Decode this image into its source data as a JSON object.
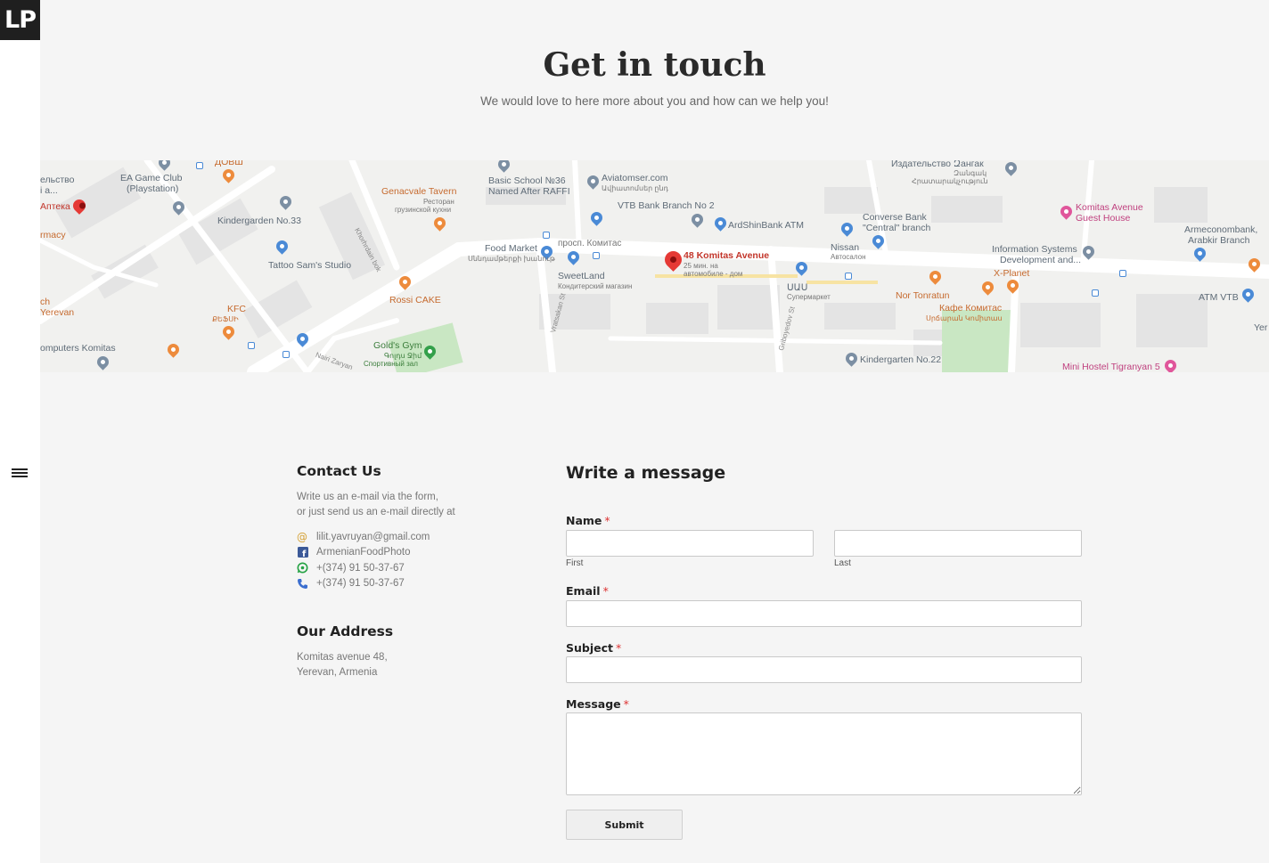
{
  "brand": {
    "logo_text": "LP"
  },
  "hero": {
    "title": "Get in touch",
    "subtitle": "We would love to here more about you and how can we help you!"
  },
  "map": {
    "main_marker": {
      "name": "48 Komitas Avenue",
      "sub1": "25 мин. на",
      "sub2": "автомобиле - дом"
    },
    "labels": {
      "ea_game_club": "EA Game Club",
      "ea_game_club_2": "(Playstation)",
      "kindergarden33": "Kindergarden No.33",
      "tattoo": "Tattoo Sam's Studio",
      "genacvale": "Genacvale Tavern",
      "genacvale_sub1": "Ресторан",
      "genacvale_sub2": "грузинской кухни",
      "basic_school": "Basic School №36",
      "basic_school_2": "Named After RAFFI",
      "aviatomser": "Aviatomser.com",
      "aviatomser_sub": "Ավիատոմսեր ընդ",
      "vtb2": "VTB Bank Branch No 2",
      "ardshin": "ArdShinBank ATM",
      "converse": "Converse Bank",
      "converse_2": "\"Central\" branch",
      "izdatelstvo": "Издательство Զангак",
      "izdatelstvo_2": "Զանգակ",
      "izdatelstvo_3": "Հրատարակչություն",
      "komitas_guest": "Komitas Avenue",
      "komitas_guest_2": "Guest House",
      "armeconom": "Armeconombank,",
      "armeconom_2": "Arabkir Branch",
      "info_systems": "Information Systems",
      "info_systems_2": "Development and...",
      "x_planet": "X-Planet",
      "nor_tonratun": "Nor Tonratun",
      "cafe_komitas": "Кафе Комитас",
      "cafe_komitas_sub": "Սրճարան Կոմիտաս",
      "atm_vtb": "ATM VTB",
      "nissan": "Nissan",
      "nissan_sub": "Автосалон",
      "uuu": "ՍԱՍ",
      "uuu_sub": "Супермаркет",
      "food_market": "Food Market",
      "food_market_sub": "Սննդամթերքի խանութ",
      "prosp": "просп. Комитас",
      "sweetland": "SweetLand",
      "sweetland_sub": "Кондитерский магазин",
      "rossi": "Rossi CAKE",
      "kfc": "KFC",
      "kfc_sub": "ՔԵՖՍԻ",
      "golds_gym": "Gold's Gym",
      "golds_gym_sub1": "Գոլդս Ջիմ",
      "golds_gym_sub2": "Спортивный зал",
      "computers_komitas": "omputers Komitas",
      "kindergarten22": "Kindergarten No.22",
      "mini_hostel": "Mini Hostel Tigranyan 5",
      "apteka": "Аптека",
      "macy": "rmacy",
      "yerevan": "Yerevan",
      "ch": "ch",
      "elstvo": "ельство",
      "ia": "і а...",
      "dovsh": "ДОВШ",
      "yer_right": "Yer",
      "street_vratsakan": "Vratsakan St",
      "street_griboyedov": "Griboyedov St",
      "street_khorhrdain": "Khorhrdain bok",
      "street_nairi": "Nairi Zaryan"
    }
  },
  "contact": {
    "heading": "Contact Us",
    "intro_line1": "Write us an e-mail via the form,",
    "intro_line2": "or just send us an e-mail directly at",
    "email": "lilit.yavruyan@gmail.com",
    "facebook": "ArmenianFoodPhoto",
    "whatsapp": "+(374) 91 50-37-67",
    "phone": "+(374) 91 50-37-67",
    "icons": {
      "email": "at-sign-icon",
      "facebook": "facebook-icon",
      "whatsapp": "whatsapp-icon",
      "phone": "phone-icon"
    },
    "colors": {
      "email": "#d4a034",
      "facebook": "#3b5998",
      "whatsapp": "#25a244",
      "phone": "#3b6ecf"
    }
  },
  "address": {
    "heading": "Our Address",
    "line1": "Komitas avenue 48,",
    "line2": "Yerevan, Armenia"
  },
  "form": {
    "title": "Write a message",
    "name_label": "Name",
    "required_mark": "*",
    "first_sublabel": "First",
    "last_sublabel": "Last",
    "email_label": "Email",
    "subject_label": "Subject",
    "message_label": "Message",
    "first_value": "",
    "last_value": "",
    "email_value": "",
    "subject_value": "",
    "message_value": "",
    "submit_label": "Submit"
  }
}
